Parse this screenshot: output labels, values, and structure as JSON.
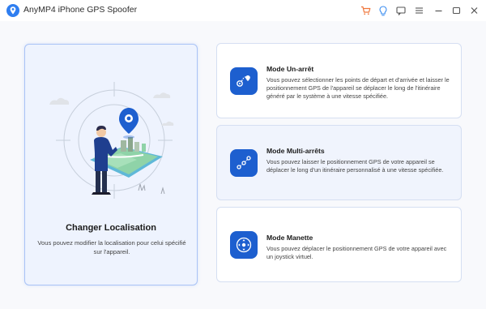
{
  "window": {
    "title": "AnyMP4 iPhone GPS Spoofer"
  },
  "titlebar_icons": [
    "cart-icon",
    "location-bulb-icon",
    "feedback-icon",
    "menu-icon",
    "minimize-icon",
    "maximize-icon",
    "close-icon"
  ],
  "colors": {
    "accent": "#1d5fcf",
    "card_border_active": "#a9c3f6",
    "cart_icon": "#f0763a",
    "bulb_icon": "#3a8df0"
  },
  "main_card": {
    "title": "Changer Localisation",
    "description": "Vous pouvez modifier la localisation pour celui spécifié sur l'appareil."
  },
  "modes": [
    {
      "title": "Mode Un-arrêt",
      "description": "Vous pouvez sélectionner les points de départ et d'arrivée et laisser le positionnement GPS de l'appareil se déplacer le long de l'itinéraire généré par le système à une vitesse spécifiée.",
      "icon": "one-stop-route-icon"
    },
    {
      "title": "Mode Multi-arrêts",
      "description": "Vous pouvez laisser le positionnement GPS de votre appareil se déplacer le long d'un itinéraire personnalisé à une vitesse spécifiée.",
      "icon": "multi-stop-route-icon"
    },
    {
      "title": "Mode Manette",
      "description": "Vous pouvez déplacer le positionnement GPS de votre appareil avec un joystick virtuel.",
      "icon": "joystick-icon"
    }
  ]
}
